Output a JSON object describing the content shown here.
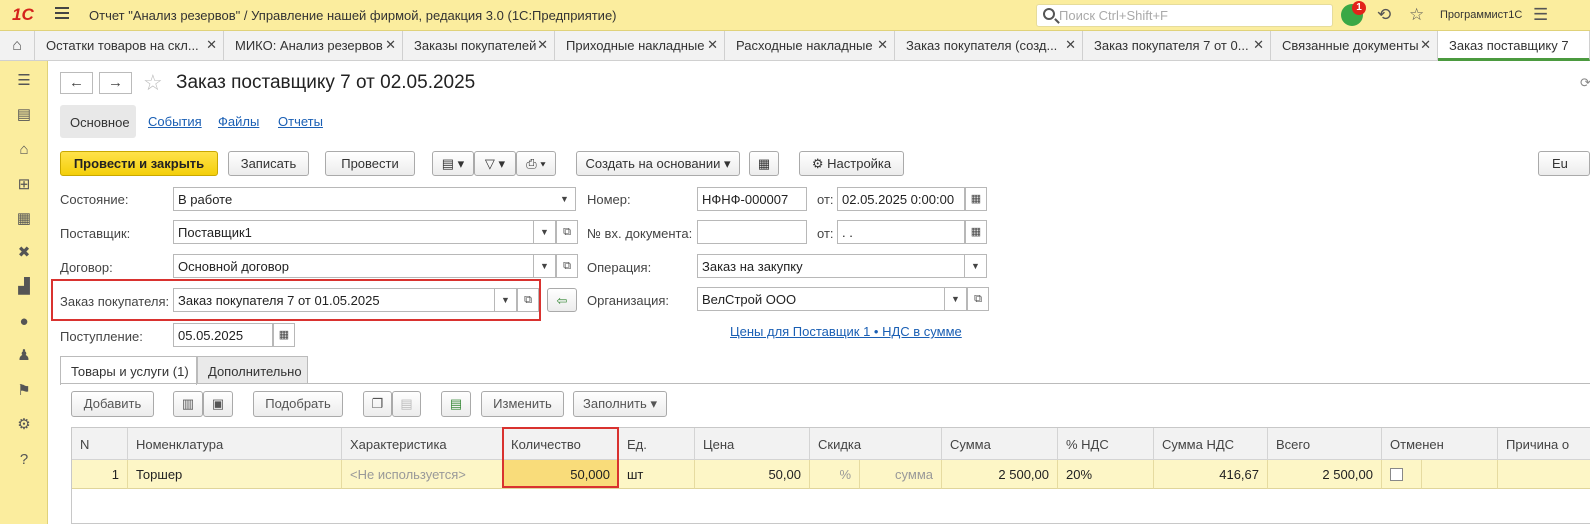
{
  "app": {
    "logo": "1С",
    "title": "Отчет \"Анализ резервов\" / Управление нашей фирмой, редакция 3.0  (1С:Предприятие)",
    "search_placeholder": "Поиск Ctrl+Shift+F",
    "notification_count": "1",
    "user": "Программист1С"
  },
  "tabs": [
    {
      "label": "Остатки товаров на скл...",
      "close": "✕"
    },
    {
      "label": "МИКО: Анализ резервов",
      "close": "✕"
    },
    {
      "label": "Заказы покупателей",
      "close": "✕"
    },
    {
      "label": "Приходные накладные",
      "close": "✕"
    },
    {
      "label": "Расходные накладные",
      "close": "✕"
    },
    {
      "label": "Заказ покупателя (созд...",
      "close": "✕"
    },
    {
      "label": "Заказ покупателя 7 от 0...",
      "close": "✕"
    },
    {
      "label": "Связанные документы",
      "close": "✕"
    },
    {
      "label": "Заказ поставщику 7"
    }
  ],
  "doc": {
    "title": "Заказ поставщику 7 от 02.05.2025"
  },
  "section_tabs": [
    "Основное",
    "События",
    "Файлы",
    "Отчеты"
  ],
  "toolbar": {
    "post_close": "Провести и закрыть",
    "save": "Записать",
    "post": "Провести",
    "create_based": "Создать на основании",
    "settings": "Настройка",
    "right_cut": "Eu"
  },
  "form": {
    "state_label": "Состояние:",
    "state": "В работе",
    "supplier_label": "Поставщик:",
    "supplier": "Поставщик1",
    "contract_label": "Договор:",
    "contract": "Основной договор",
    "customer_order_label": "Заказ покупателя:",
    "customer_order": "Заказ покупателя 7 от 01.05.2025",
    "arrival_label": "Поступление:",
    "arrival": "05.05.2025",
    "number_label": "Номер:",
    "number": "НФНФ-000007",
    "from_label": "от:",
    "date": "02.05.2025  0:00:00",
    "incoming_label": "№ вх. документа:",
    "incoming": "",
    "incoming_date": " .  .",
    "operation_label": "Операция:",
    "operation": "Заказ на закупку",
    "org_label": "Организация:",
    "org": "ВелСтрой ООО",
    "prices_link": "Цены для Поставщик 1 • НДС в сумме"
  },
  "inner_tabs": [
    "Товары и услуги (1)",
    "Дополнительно"
  ],
  "table_toolbar": {
    "add": "Добавить",
    "select": "Подобрать",
    "change": "Изменить",
    "fill": "Заполнить"
  },
  "table": {
    "headers": [
      "N",
      "Номенклатура",
      "Характеристика",
      "Количество",
      "Ед.",
      "Цена",
      "Скидка",
      "Сумма",
      "% НДС",
      "Сумма НДС",
      "Всего",
      "Отменен",
      "Причина о"
    ],
    "rows": [
      {
        "n": "1",
        "item": "Торшер",
        "characteristic": "<Не используется>",
        "qty": "50,000",
        "unit": "шт",
        "price": "50,00",
        "discount_pct": "%",
        "discount_sum": "сумма",
        "sum": "2 500,00",
        "vat_rate": "20%",
        "vat_sum": "416,67",
        "total": "2 500,00"
      }
    ]
  },
  "colors": {
    "accent_yellow": "#fbed9e",
    "primary_button": "#f4cf0a",
    "highlight_red": "#d9322f",
    "active_tab_green": "#4b9a3f"
  }
}
